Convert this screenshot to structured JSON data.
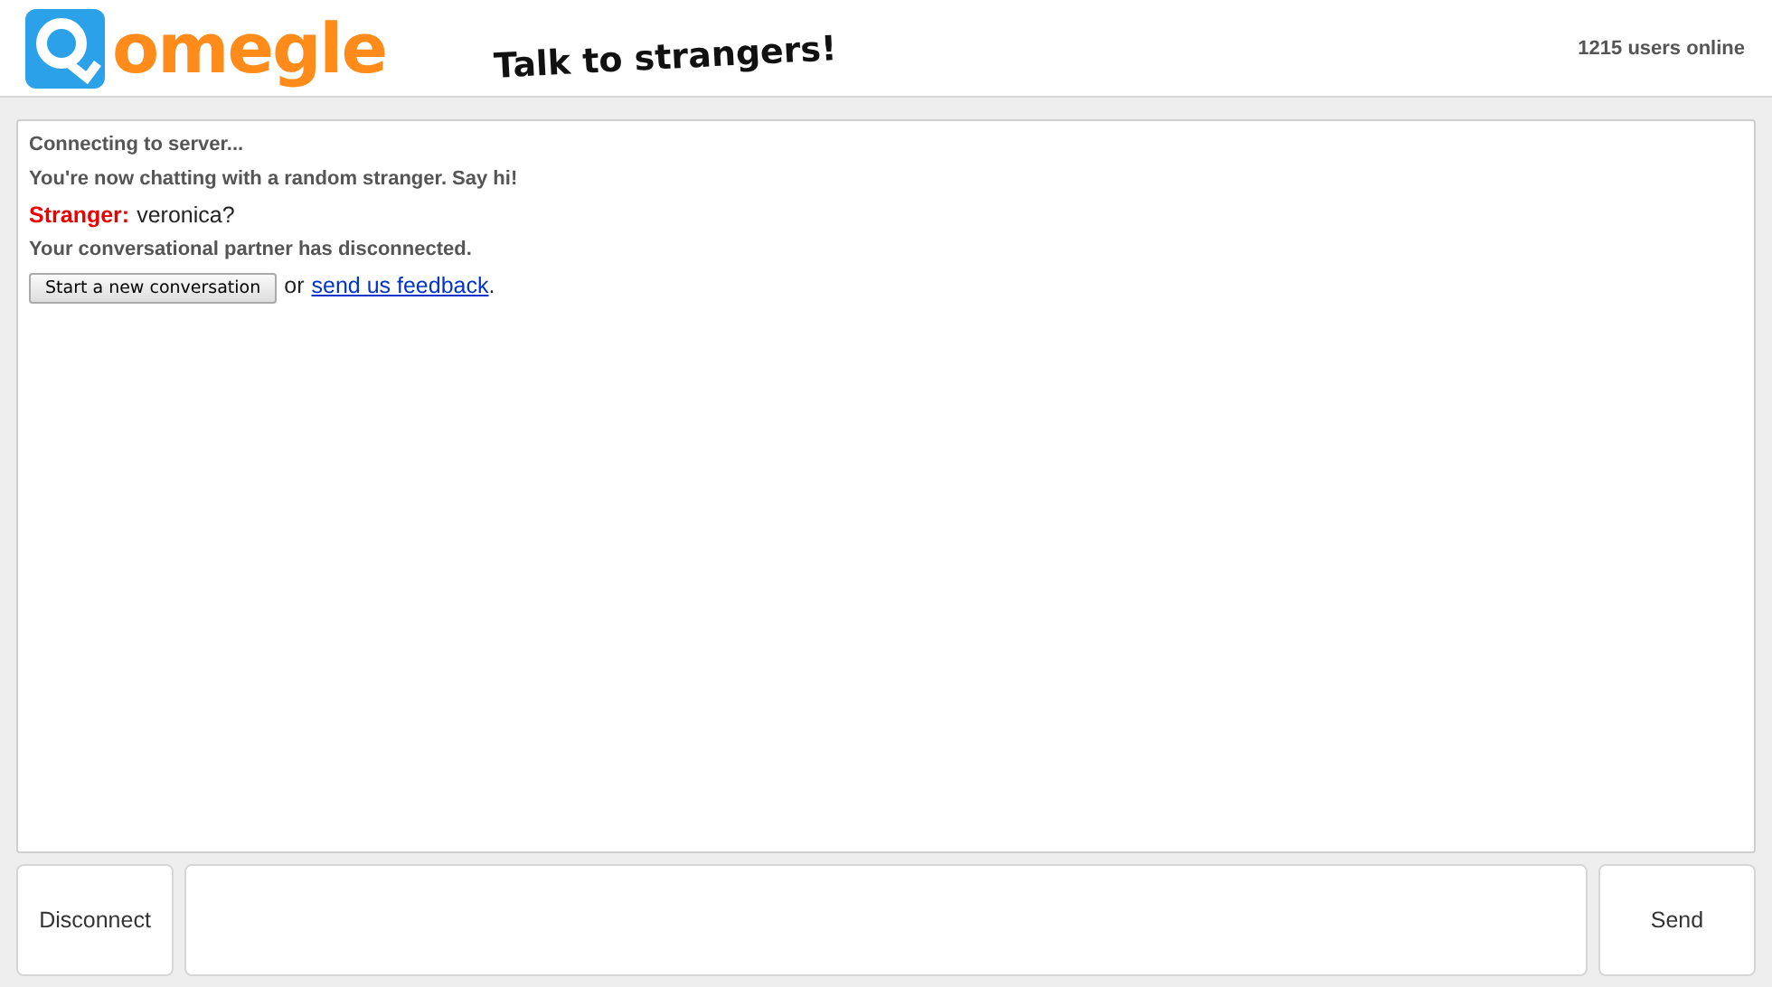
{
  "header": {
    "logo_text": "omegle",
    "tagline": "Talk to strangers!",
    "users_online": "1215 users online"
  },
  "log": [
    {
      "kind": "status",
      "text": "Connecting to server..."
    },
    {
      "kind": "status",
      "text": "You're now chatting with a random stranger. Say hi!"
    },
    {
      "kind": "stranger",
      "label": "Stranger:",
      "text": "veronica?"
    },
    {
      "kind": "status",
      "text": "Your conversational partner has disconnected."
    },
    {
      "kind": "actions",
      "button": "Start a new conversation",
      "or": "or",
      "link": "send us feedback",
      "end": "."
    }
  ],
  "controls": {
    "disconnect": "Disconnect",
    "send": "Send"
  }
}
